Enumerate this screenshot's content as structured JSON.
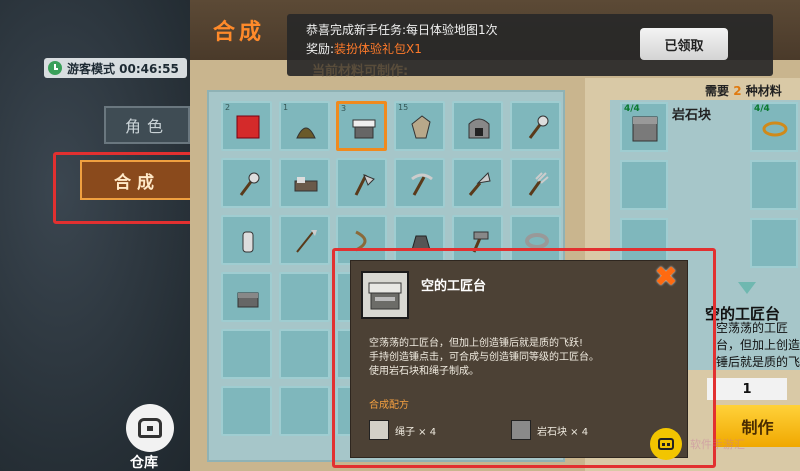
{
  "left": {
    "timer_text": "游客模式 00:46:55",
    "tab_role": "角色",
    "tab_craft": "合成",
    "storage_label": "仓库"
  },
  "header": {
    "title": "合成",
    "notice_line1": "恭喜完成新手任务:每日体验地图1次",
    "notice_line2_prefix": "奖励:",
    "notice_line2_reward": "装扮体验礼包X1",
    "claimed_button": "已领取",
    "sub_caption": "当前材料可制作:"
  },
  "grid": {
    "items": [
      {
        "name": "red-block-icon",
        "num": "2"
      },
      {
        "name": "plant-sack-icon",
        "num": "1"
      },
      {
        "name": "workbench-icon",
        "num": "3",
        "selected": true
      },
      {
        "name": "stone-shard-icon",
        "num": "15"
      },
      {
        "name": "furnace-icon",
        "num": ""
      },
      {
        "name": "torch-icon",
        "num": ""
      },
      {
        "name": "torch-icon",
        "num": ""
      },
      {
        "name": "bed-icon",
        "num": ""
      },
      {
        "name": "axe-icon",
        "num": ""
      },
      {
        "name": "pickaxe-icon",
        "num": ""
      },
      {
        "name": "shovel-icon",
        "num": ""
      },
      {
        "name": "rake-icon",
        "num": ""
      },
      {
        "name": "bottle-icon",
        "num": ""
      },
      {
        "name": "spear-icon",
        "num": ""
      },
      {
        "name": "bow-icon",
        "num": ""
      },
      {
        "name": "pot-icon",
        "num": ""
      },
      {
        "name": "hammer-icon",
        "num": ""
      },
      {
        "name": "ring-icon",
        "num": ""
      },
      {
        "name": "chest-icon",
        "num": ""
      }
    ]
  },
  "right": {
    "req_prefix": "需要",
    "req_count": "2",
    "req_suffix": "种材料",
    "rock_label": "岩石块",
    "rock_count": "4/4",
    "rope_count": "4/4",
    "title_behind": "空的工匠台",
    "desc_behind": "空荡荡的工匠台，但加上创造锤后就是质的飞跃!手持创造锤点击，可合成与创造锤同等级的工匠台。",
    "quantity": "1",
    "make_button": "制作"
  },
  "tooltip": {
    "title": "空的工匠台",
    "desc_line1": "空荡荡的工匠台，但加上创造锤后就是质的飞跃!",
    "desc_line2": "手持创造锤点击，可合成与创造锤同等级的工匠台。",
    "desc_line3": "使用岩石块和绳子制成。",
    "recipe_title": "合成配方",
    "recipe1": "绳子 × 4",
    "recipe2": "岩石块 × 4",
    "close_label": "✖"
  },
  "watermark": {
    "text": "软件手游汇"
  },
  "colors": {
    "accent": "#f08a1e",
    "highlight_red": "#e23030",
    "slot_bg": "#7fb7bc",
    "make_button": "#ffd23a"
  }
}
